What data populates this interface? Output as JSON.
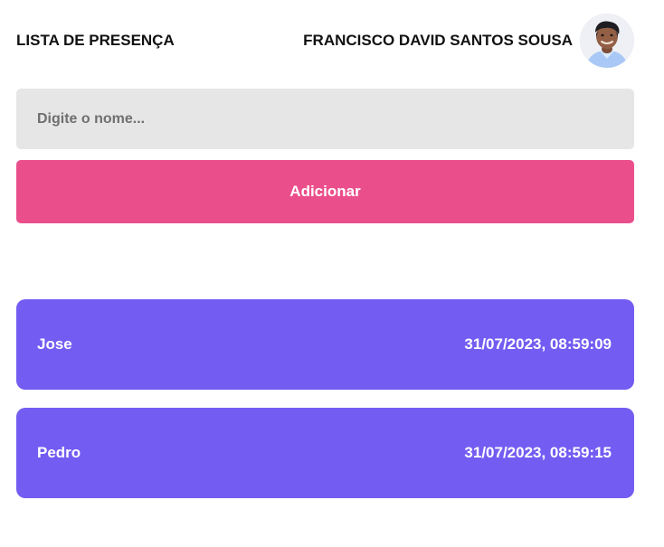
{
  "header": {
    "title": "LISTA DE PRESENÇA",
    "user_name": "FRANCISCO DAVID SANTOS SOUSA"
  },
  "form": {
    "placeholder": "Digite o nome...",
    "button_label": "Adicionar"
  },
  "students": [
    {
      "name": "Jose",
      "time": "31/07/2023, 08:59:09"
    },
    {
      "name": "Pedro",
      "time": "31/07/2023, 08:59:15"
    }
  ],
  "colors": {
    "button": "#EA4F8C",
    "card": "#735CF2",
    "input_bg": "#E6E6E6"
  }
}
